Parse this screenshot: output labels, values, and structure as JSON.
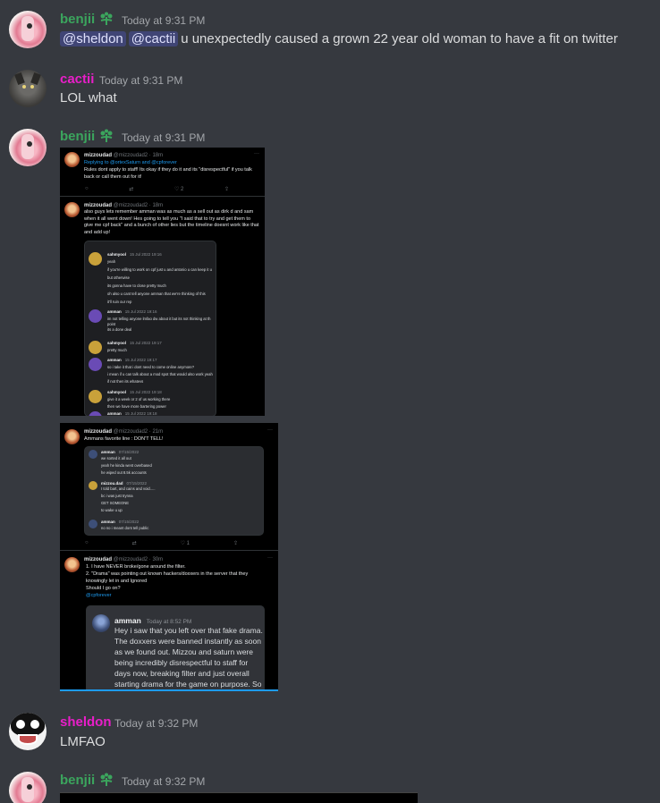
{
  "messages": [
    {
      "author": "benjii",
      "time": "Today at 9:31 PM",
      "mentions": [
        "@sheldon",
        "@cactii"
      ],
      "text": "u unexpectedly caused a grown 22 year old woman to have a fit on twitter"
    },
    {
      "author": "cactii",
      "time": "Today at 9:31 PM",
      "text": "LOL what"
    },
    {
      "author": "benjii",
      "time": "Today at 9:31 PM"
    },
    {
      "author": "sheldon",
      "time": "Today at 9:32 PM",
      "text": "LMFAO"
    },
    {
      "author": "benjii",
      "time": "Today at 9:32 PM"
    }
  ],
  "colors": {
    "benjii": "#3ba55d",
    "cactii": "#e91ec9",
    "sheldon": "#e91ec9",
    "mention_bg": "#3c4270",
    "background": "#36393f"
  },
  "icons": {
    "badge": "sprout-icon"
  },
  "screenshot1": {
    "tweet1": {
      "name": "mizzoudad",
      "handle": "@mizzoudad2 · 18m",
      "reply_to": "Replying to @ortexSaturn and @cpforever",
      "body": "Rules dont apply to staff! Its okay if they do it and its \"disrespectful\" if you talk back or call them out for it!",
      "like_count": "2"
    },
    "tweet2": {
      "name": "mizzoudad",
      "handle": "@mizzoudad2 · 18m",
      "body": "also guys lets remember amman was as much as a sell out as dirk d and sam when it all went down! Hes going to tell you \"I said that to try and get them to give me cpf back\" and a bunch of other lies but the timeline doesnt work like that and add up!"
    },
    "dms": [
      {
        "name": "sahmyool",
        "time": "15 Jul 2022 19:16",
        "lines": [
          "yeah",
          "if you're willing to work on cpf just u and antonio u can keep it u",
          "but otherwise",
          "its gonna have to close pretty much",
          "oh also u cant tell anyone amman that we're thinking of this",
          "it'll ruin our rep"
        ]
      },
      {
        "name": "amman",
        "time": "15 Jul 2022 19:16",
        "lines": [
          "im not telling anyone lmfao dw about it but its not thinking at th",
          "point",
          "its a done deal"
        ]
      },
      {
        "name": "sahmyool",
        "time": "15 Jul 2022 19:17",
        "lines": [
          "pretty much"
        ]
      },
      {
        "name": "amman",
        "time": "15 Jul 2022 19:17",
        "lines": [
          "so i take it that i dont need to come online anymore?",
          "i mean if u can talk about a mod spot that would also work yeah",
          "if not then its whatevs"
        ]
      },
      {
        "name": "sahmyool",
        "time": "15 Jul 2022 19:18",
        "lines": [
          "give it a week or 2 of us working there",
          "then we have more bartering power"
        ]
      },
      {
        "name": "amman",
        "time": "15 Jul 2022 19:18",
        "lines": []
      }
    ]
  },
  "screenshot2": {
    "tweet1": {
      "name": "mizzoudad",
      "handle": "@mizzoudad2 · 21m",
      "body": "Ammans favorite line : DON'T TELL!",
      "like_count": "1"
    },
    "dms": [
      {
        "name": "amman",
        "time": "07/15/2022",
        "lines": [
          "we sorted it all out",
          "yeah he kinda went overbased",
          "he wiped out 8.5k accounts"
        ]
      },
      {
        "name": "mizzou.dad",
        "time": "07/15/2022",
        "lines": [
          "I told bart, and cains and void.....",
          "bc i was just trynna",
          "GET SOMEONE",
          "to wake u up"
        ]
      },
      {
        "name": "amman",
        "time": "07/15/2022",
        "lines": [
          "no no i meant dont tell public"
        ]
      }
    ],
    "tweet2": {
      "name": "mizzoudad",
      "handle": "@mizzoudad2 · 30m",
      "lines": [
        "1. I have NEVER broke/gone around the filter.",
        "2. \"Drama\" was pointing out known hackers/doxxers in the server that they",
        "knowingly let in and Ignored",
        "Should I go on?"
      ],
      "mention": "@cpforever"
    },
    "embed": {
      "name": "amman",
      "time": "Today at 8:52 PM",
      "lines": [
        "Hey i saw that you left over that fake drama.",
        "The doxxers were banned instantly as soon",
        "as we found out. Mizzou and saturn were",
        "being incredibly disrespectful to staff for",
        "days now, breaking filter and just overall",
        "starting drama for the game on purpose. So"
      ]
    }
  }
}
